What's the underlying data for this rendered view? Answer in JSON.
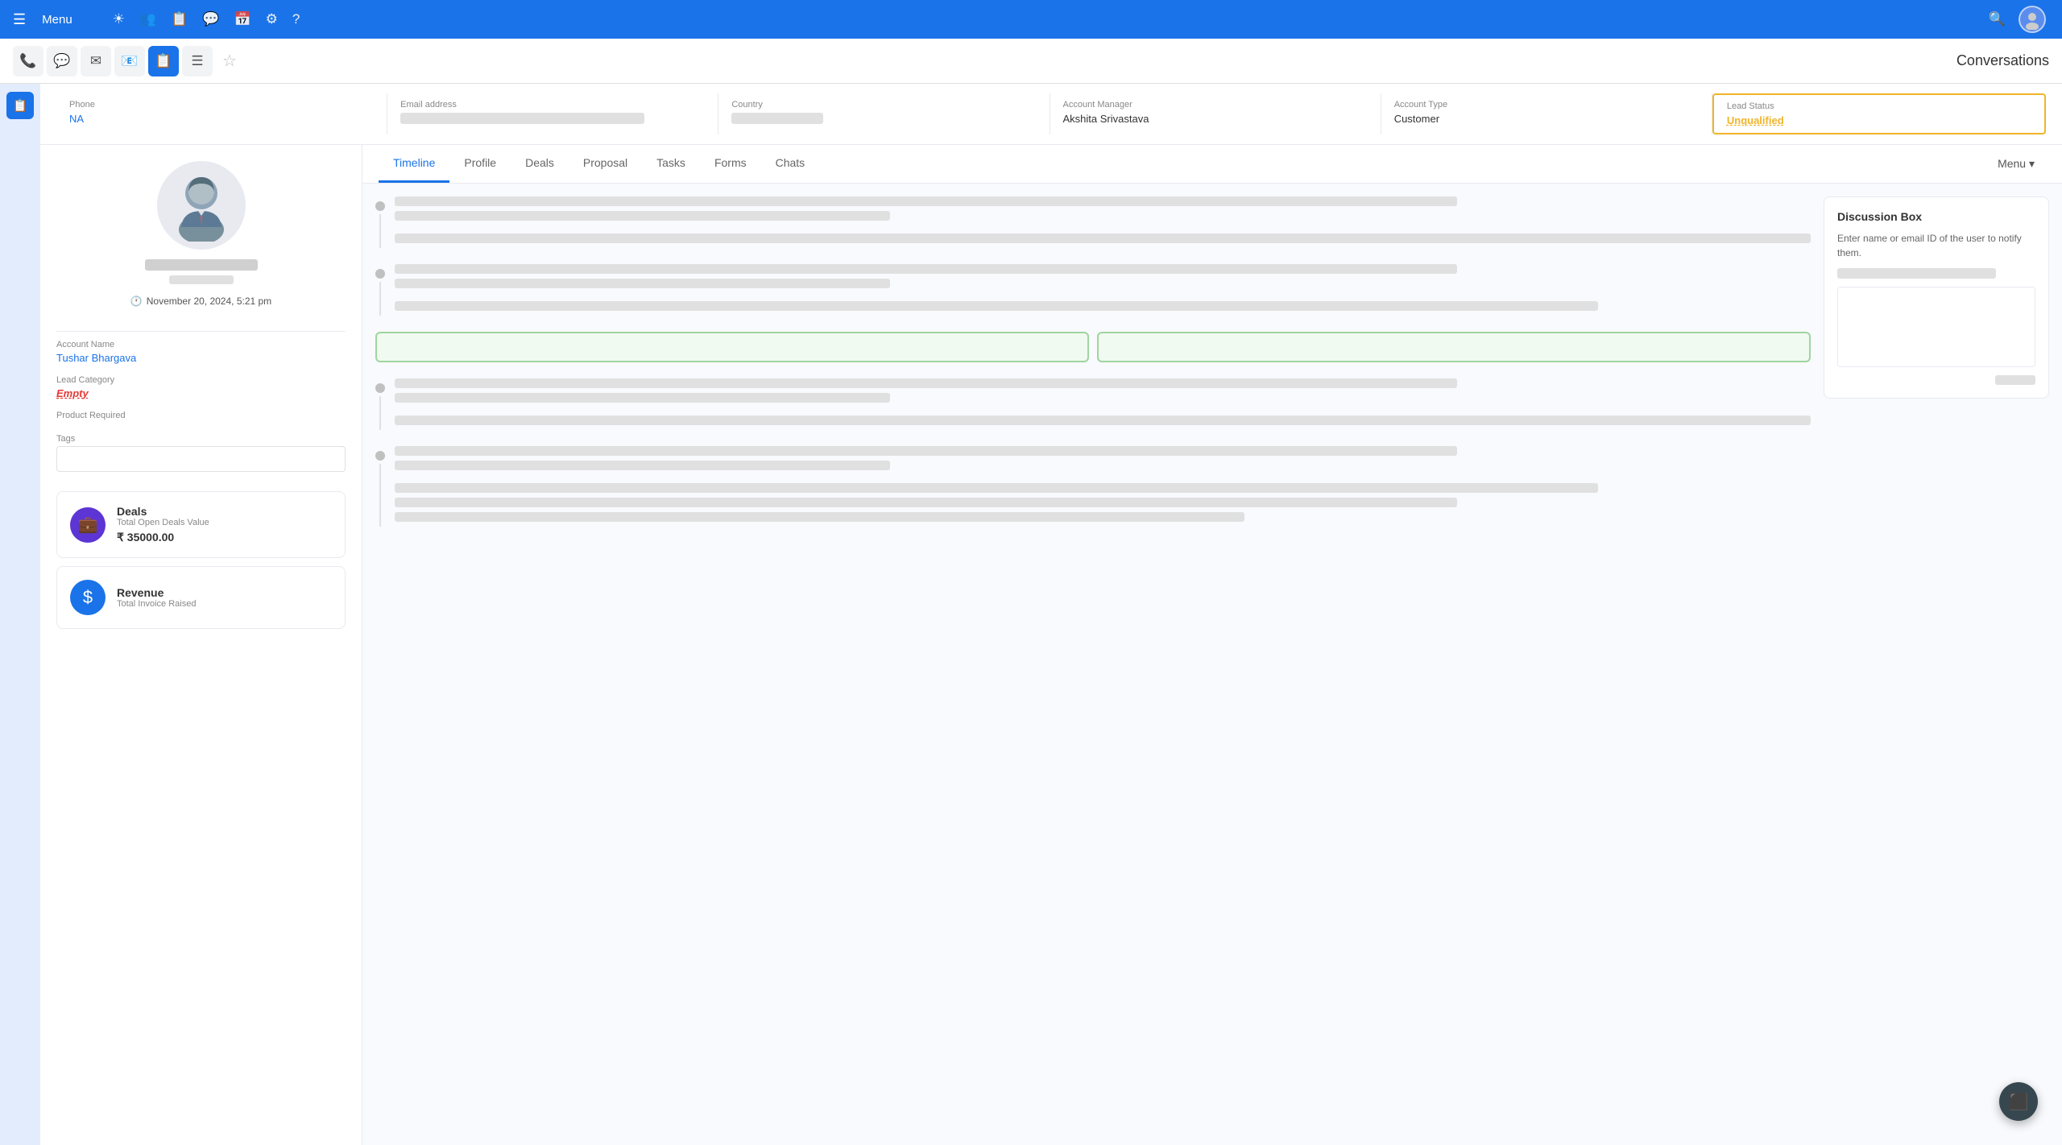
{
  "nav": {
    "menu_label": "Menu",
    "hamburger_icon": "☰",
    "icons": [
      "☀",
      "👥",
      "📋",
      "💬",
      "📅",
      "⚙",
      "?"
    ],
    "conversations_label": "Conversations"
  },
  "toolbar": {
    "icons": [
      "📞",
      "💬",
      "✉",
      "📧",
      "📋",
      "☰"
    ],
    "active_index": 3,
    "star_icon": "☆"
  },
  "info_fields": {
    "phone_label": "Phone",
    "phone_value": "NA",
    "email_label": "Email address",
    "country_label": "Country",
    "account_manager_label": "Account Manager",
    "account_manager_value": "Akshita Srivastava",
    "account_type_label": "Account Type",
    "account_type_value": "Customer",
    "lead_status_label": "Lead Status",
    "lead_status_value": "Unqualified"
  },
  "profile": {
    "date": "November 20, 2024, 5:21 pm",
    "account_name_label": "Account Name",
    "account_name_value": "Tushar Bhargava",
    "lead_category_label": "Lead Category",
    "lead_category_value": "Empty",
    "product_required_label": "Product Required",
    "product_required_value": "",
    "tags_label": "Tags",
    "tags_placeholder": ""
  },
  "deals": {
    "title": "Deals",
    "sub_label": "Total Open Deals Value",
    "amount": "₹ 35000.00",
    "icon": "💼"
  },
  "revenue": {
    "title": "Revenue",
    "sub_label": "Total Invoice Raised",
    "icon": "$"
  },
  "tabs": {
    "items": [
      "Timeline",
      "Profile",
      "Deals",
      "Proposal",
      "Tasks",
      "Forms",
      "Chats"
    ],
    "active": "Timeline",
    "menu_label": "Menu ▾"
  },
  "discussion": {
    "title": "Discussion Box",
    "description": "Enter name or email ID of the user to notify them."
  }
}
